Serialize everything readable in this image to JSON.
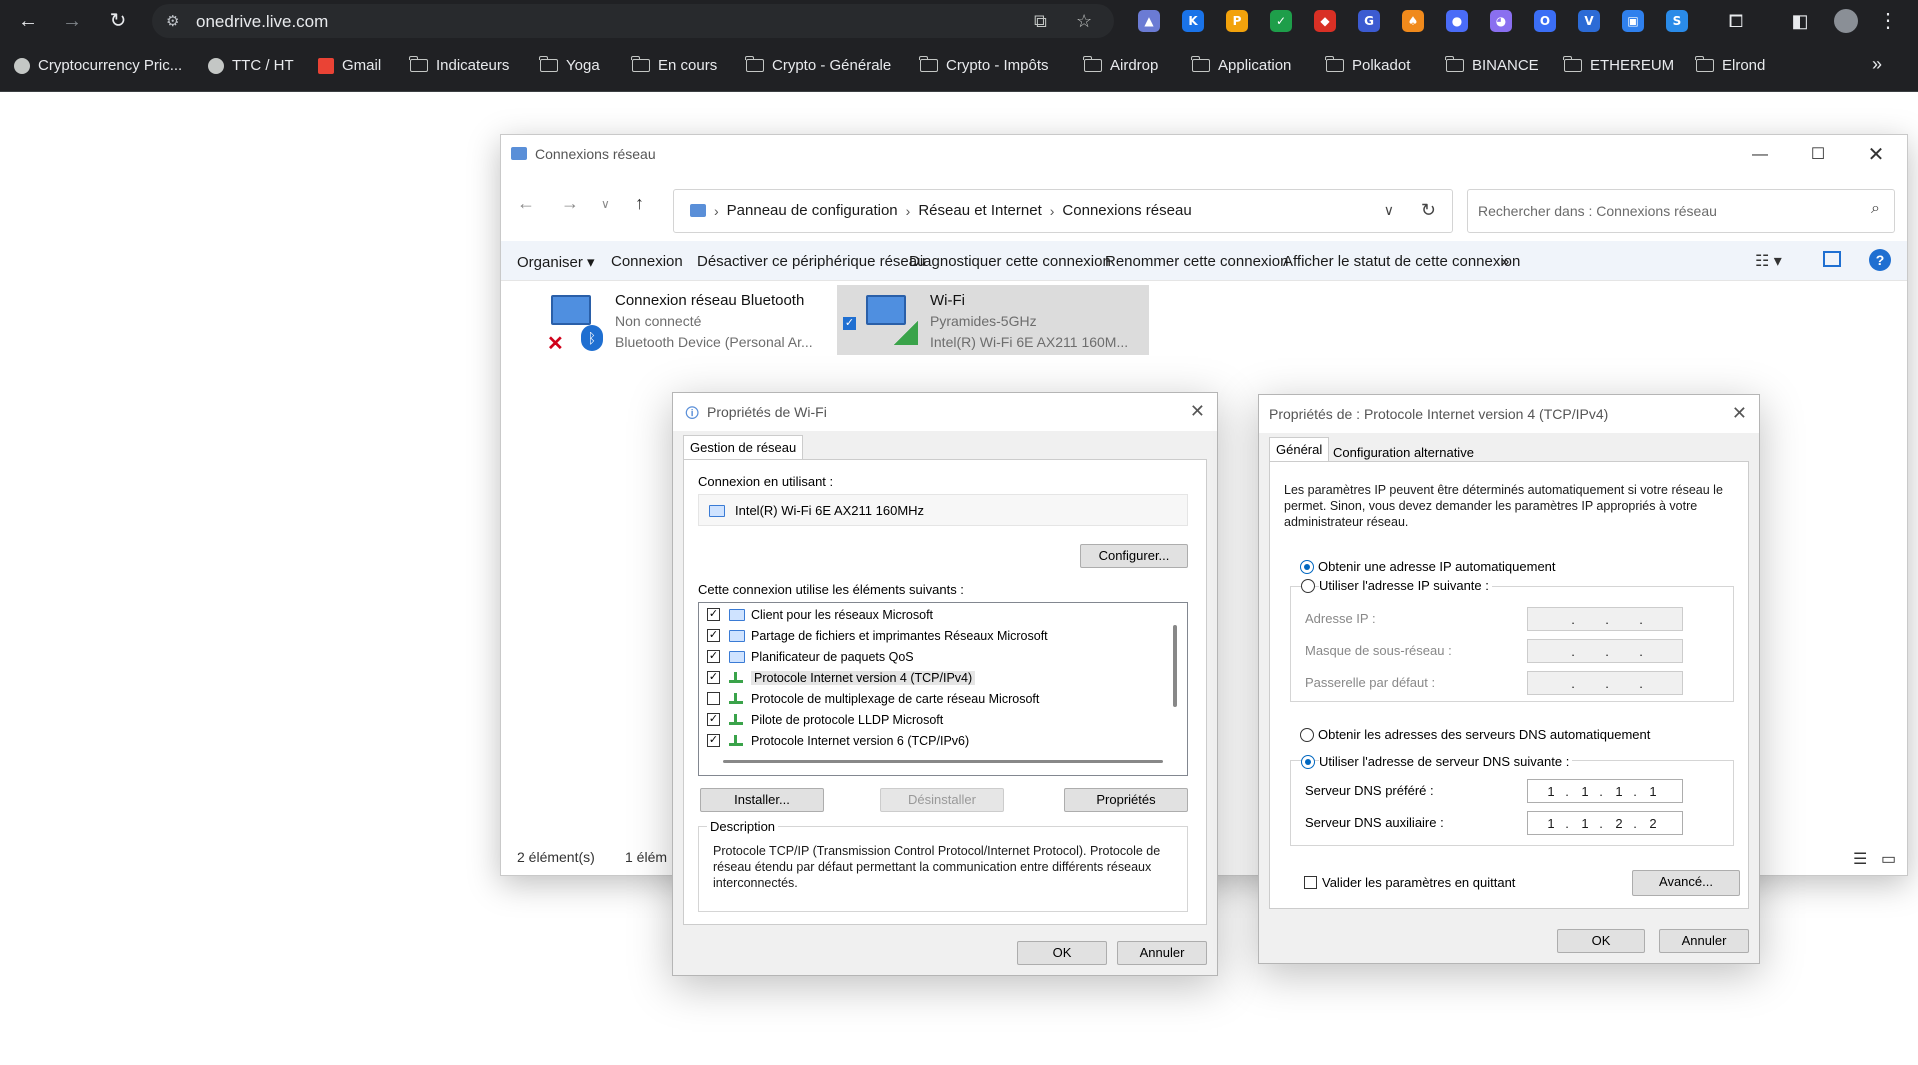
{
  "browser": {
    "url": "onedrive.live.com",
    "bookmarks": [
      {
        "label": "Cryptocurrency Pric...",
        "icon": "globe-icon"
      },
      {
        "label": "TTC / HT",
        "icon": "globe-icon"
      },
      {
        "label": "Gmail",
        "icon": "gmail-icon"
      },
      {
        "label": "Indicateurs",
        "icon": "folder-icon"
      },
      {
        "label": "Yoga",
        "icon": "folder-icon"
      },
      {
        "label": "En cours",
        "icon": "folder-icon"
      },
      {
        "label": "Crypto - Générale",
        "icon": "folder-icon"
      },
      {
        "label": "Crypto - Impôts",
        "icon": "folder-icon"
      },
      {
        "label": "Airdrop",
        "icon": "folder-icon"
      },
      {
        "label": "Application",
        "icon": "folder-icon"
      },
      {
        "label": "Polkadot",
        "icon": "folder-icon"
      },
      {
        "label": "BINANCE",
        "icon": "folder-icon"
      },
      {
        "label": "ETHEREUM",
        "icon": "folder-icon"
      },
      {
        "label": "Elrond",
        "icon": "folder-icon"
      }
    ],
    "more": "»",
    "extensions": [
      {
        "glyph": "▲",
        "color": "#6b7bd4"
      },
      {
        "glyph": "K",
        "color": "#1a73e8"
      },
      {
        "glyph": "P",
        "color": "#f2a20c"
      },
      {
        "glyph": "✓",
        "color": "#1e9e4a"
      },
      {
        "glyph": "◆",
        "color": "#d93025"
      },
      {
        "glyph": "G",
        "color": "#3c5bd1"
      },
      {
        "glyph": "♠",
        "color": "#f08a1c"
      },
      {
        "glyph": "●",
        "color": "#4a6cf7"
      },
      {
        "glyph": "◕",
        "color": "#8a6ff0"
      },
      {
        "glyph": "O",
        "color": "#3b6ef5"
      },
      {
        "glyph": "V",
        "color": "#2c6bd6"
      },
      {
        "glyph": "▣",
        "color": "#2f80ed"
      },
      {
        "glyph": "S",
        "color": "#2a8be8"
      }
    ]
  },
  "explorer": {
    "title": "Connexions réseau",
    "breadcrumb": [
      "Panneau de configuration",
      "Réseau et Internet",
      "Connexions réseau"
    ],
    "search_placeholder": "Rechercher dans : Connexions réseau",
    "commands": [
      "Organiser ▾",
      "Connexion",
      "Désactiver ce périphérique réseau",
      "Diagnostiquer cette connexion",
      "Renommer cette connexion",
      "Afficher le statut de cette connexion",
      "»"
    ],
    "adapters": [
      {
        "name": "Connexion réseau Bluetooth",
        "status": "Non connecté",
        "device": "Bluetooth Device (Personal Ar..."
      },
      {
        "name": "Wi-Fi",
        "status": "Pyramides-5GHz",
        "device": "Intel(R) Wi-Fi 6E AX211 160M..."
      }
    ],
    "status_count": "2 élément(s)",
    "status_selected": "1 élém"
  },
  "wifi_props": {
    "title": "Propriétés de Wi-Fi",
    "tab": "Gestion de réseau",
    "connect_using_label": "Connexion en utilisant :",
    "adapter": "Intel(R) Wi-Fi 6E AX211 160MHz",
    "configure": "Configurer...",
    "items_label": "Cette connexion utilise les éléments suivants :",
    "items": [
      {
        "label": "Client pour les réseaux Microsoft",
        "checked": true
      },
      {
        "label": "Partage de fichiers et imprimantes Réseaux Microsoft",
        "checked": true
      },
      {
        "label": "Planificateur de paquets QoS",
        "checked": true
      },
      {
        "label": "Protocole Internet version 4 (TCP/IPv4)",
        "checked": true
      },
      {
        "label": "Protocole de multiplexage de carte réseau Microsoft",
        "checked": false
      },
      {
        "label": "Pilote de protocole LLDP Microsoft",
        "checked": true
      },
      {
        "label": "Protocole Internet version 6 (TCP/IPv6)",
        "checked": true
      }
    ],
    "install": "Installer...",
    "uninstall": "Désinstaller",
    "properties": "Propriétés",
    "description_label": "Description",
    "description": "Protocole TCP/IP (Transmission Control Protocol/Internet Protocol). Protocole de réseau étendu par défaut permettant la communication entre différents réseaux interconnectés.",
    "ok": "OK",
    "cancel": "Annuler"
  },
  "ipv4_props": {
    "title": "Propriétés de : Protocole Internet version 4 (TCP/IPv4)",
    "tab_general": "Général",
    "tab_alt": "Configuration alternative",
    "intro": "Les paramètres IP peuvent être déterminés automatiquement si votre réseau le permet. Sinon, vous devez demander les paramètres IP appropriés à votre administrateur réseau.",
    "auto_ip": "Obtenir une adresse IP automatiquement",
    "manual_ip": "Utiliser l'adresse IP suivante :",
    "ip_label": "Adresse IP :",
    "mask_label": "Masque de sous-réseau :",
    "gateway_label": "Passerelle par défaut :",
    "auto_dns": "Obtenir les adresses des serveurs DNS automatiquement",
    "manual_dns": "Utiliser l'adresse de serveur DNS suivante :",
    "dns_pref_label": "Serveur DNS préféré :",
    "dns_pref": [
      "1",
      "1",
      "1",
      "1"
    ],
    "dns_alt_label": "Serveur DNS auxiliaire :",
    "dns_alt": [
      "1",
      "1",
      "2",
      "2"
    ],
    "validate": "Valider les paramètres en quittant",
    "advanced": "Avancé...",
    "ok": "OK",
    "cancel": "Annuler"
  }
}
